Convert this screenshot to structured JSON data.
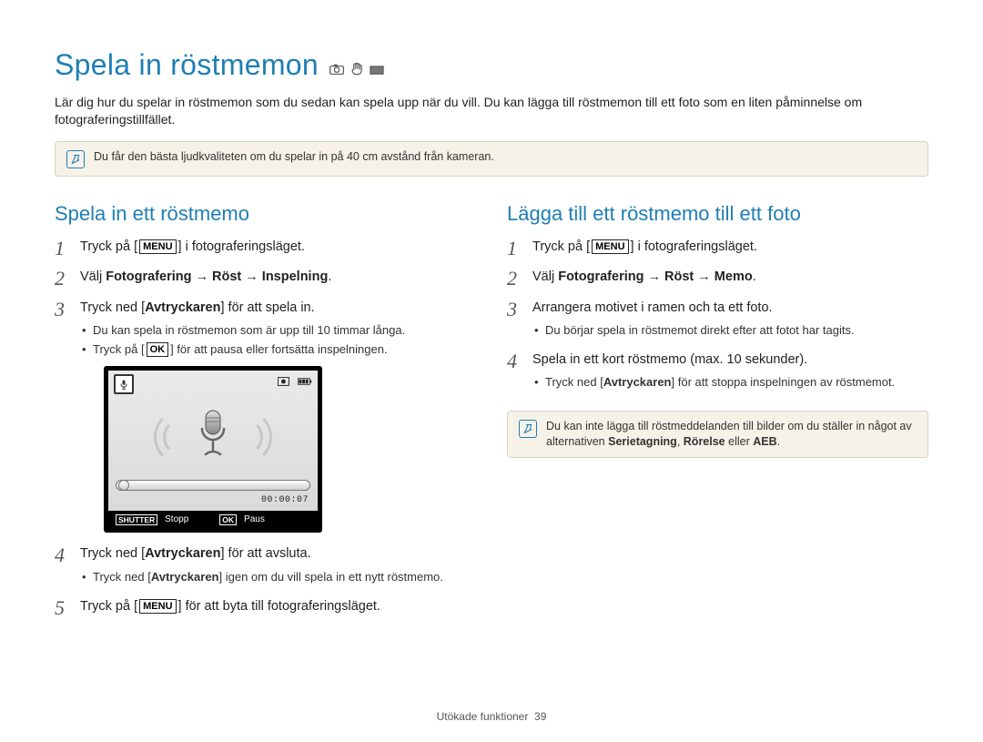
{
  "title": "Spela in röstmemon",
  "intro": "Lär dig hur du spelar in röstmemon som du sedan kan spela upp när du vill. Du kan lägga till röstmemon till ett foto som en liten påminnelse om fotograferingstillfället.",
  "note1": "Du får den bästa ljudkvaliteten om du spelar in på 40 cm avstånd från kameran.",
  "btn": {
    "menu": "MENU",
    "ok": "OK",
    "shutter": "SHUTTER"
  },
  "left": {
    "heading": "Spela in ett röstmemo",
    "steps": [
      {
        "n": "1",
        "pre": "Tryck på [",
        "kbd": "menu",
        "post": "] i fotograferingsläget."
      },
      {
        "n": "2",
        "pre": "Välj ",
        "bold": "Fotografering → Röst → Inspelning",
        "post": "."
      },
      {
        "n": "3",
        "pre": "Tryck ned [",
        "bold": "Avtryckaren",
        "post": "] för att spela in.",
        "bullets": [
          {
            "text": "Du kan spela in röstmemon som är upp till 10 timmar långa."
          },
          {
            "pre": "Tryck på [",
            "kbd": "ok",
            "post": "] för att pausa eller fortsätta inspelningen."
          }
        ]
      },
      {
        "n": "4",
        "pre": "Tryck ned [",
        "bold": "Avtryckaren",
        "post": "] för att avsluta.",
        "bullets": [
          {
            "pre": "Tryck ned [",
            "bold": "Avtryckaren",
            "post": "] igen om du vill spela in ett nytt röstmemo."
          }
        ]
      },
      {
        "n": "5",
        "pre": "Tryck på [",
        "kbd": "menu",
        "post": "] för att byta till fotograferingsläget."
      }
    ],
    "lcd": {
      "timer": "00:00:07",
      "f1_label": "Stopp",
      "f2_label": "Paus"
    }
  },
  "right": {
    "heading": "Lägga till ett röstmemo till ett foto",
    "steps": [
      {
        "n": "1",
        "pre": "Tryck på [",
        "kbd": "menu",
        "post": "] i fotograferingsläget."
      },
      {
        "n": "2",
        "pre": "Välj ",
        "bold": "Fotografering → Röst → Memo",
        "post": "."
      },
      {
        "n": "3",
        "text": "Arrangera motivet i ramen och ta ett foto.",
        "bullets": [
          {
            "text": "Du börjar spela in röstmemot direkt efter att fotot har tagits."
          }
        ]
      },
      {
        "n": "4",
        "text": "Spela in ett kort röstmemo (max. 10 sekunder).",
        "bullets": [
          {
            "pre": "Tryck ned [",
            "bold": "Avtryckaren",
            "post": "] för att stoppa inspelningen av röstmemot."
          }
        ]
      }
    ],
    "note": {
      "pre": "Du kan inte lägga till röstmeddelanden till bilder om du ställer in något av alternativen ",
      "b1": "Serietagning",
      "sep1": ", ",
      "b2": "Rörelse",
      "sep2": " eller ",
      "b3": "AEB",
      "post": "."
    }
  },
  "footer": {
    "label": "Utökade funktioner",
    "page": "39"
  }
}
